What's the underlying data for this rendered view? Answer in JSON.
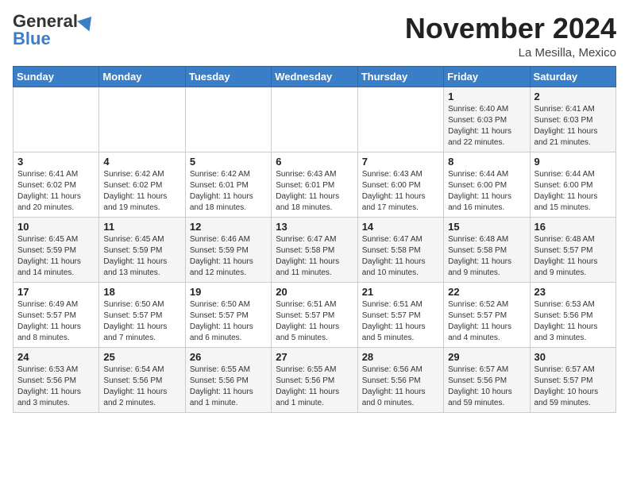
{
  "logo": {
    "general": "General",
    "blue": "Blue"
  },
  "title": "November 2024",
  "location": "La Mesilla, Mexico",
  "days_of_week": [
    "Sunday",
    "Monday",
    "Tuesday",
    "Wednesday",
    "Thursday",
    "Friday",
    "Saturday"
  ],
  "weeks": [
    [
      {
        "day": "",
        "info": ""
      },
      {
        "day": "",
        "info": ""
      },
      {
        "day": "",
        "info": ""
      },
      {
        "day": "",
        "info": ""
      },
      {
        "day": "",
        "info": ""
      },
      {
        "day": "1",
        "info": "Sunrise: 6:40 AM\nSunset: 6:03 PM\nDaylight: 11 hours\nand 22 minutes."
      },
      {
        "day": "2",
        "info": "Sunrise: 6:41 AM\nSunset: 6:03 PM\nDaylight: 11 hours\nand 21 minutes."
      }
    ],
    [
      {
        "day": "3",
        "info": "Sunrise: 6:41 AM\nSunset: 6:02 PM\nDaylight: 11 hours\nand 20 minutes."
      },
      {
        "day": "4",
        "info": "Sunrise: 6:42 AM\nSunset: 6:02 PM\nDaylight: 11 hours\nand 19 minutes."
      },
      {
        "day": "5",
        "info": "Sunrise: 6:42 AM\nSunset: 6:01 PM\nDaylight: 11 hours\nand 18 minutes."
      },
      {
        "day": "6",
        "info": "Sunrise: 6:43 AM\nSunset: 6:01 PM\nDaylight: 11 hours\nand 18 minutes."
      },
      {
        "day": "7",
        "info": "Sunrise: 6:43 AM\nSunset: 6:00 PM\nDaylight: 11 hours\nand 17 minutes."
      },
      {
        "day": "8",
        "info": "Sunrise: 6:44 AM\nSunset: 6:00 PM\nDaylight: 11 hours\nand 16 minutes."
      },
      {
        "day": "9",
        "info": "Sunrise: 6:44 AM\nSunset: 6:00 PM\nDaylight: 11 hours\nand 15 minutes."
      }
    ],
    [
      {
        "day": "10",
        "info": "Sunrise: 6:45 AM\nSunset: 5:59 PM\nDaylight: 11 hours\nand 14 minutes."
      },
      {
        "day": "11",
        "info": "Sunrise: 6:45 AM\nSunset: 5:59 PM\nDaylight: 11 hours\nand 13 minutes."
      },
      {
        "day": "12",
        "info": "Sunrise: 6:46 AM\nSunset: 5:59 PM\nDaylight: 11 hours\nand 12 minutes."
      },
      {
        "day": "13",
        "info": "Sunrise: 6:47 AM\nSunset: 5:58 PM\nDaylight: 11 hours\nand 11 minutes."
      },
      {
        "day": "14",
        "info": "Sunrise: 6:47 AM\nSunset: 5:58 PM\nDaylight: 11 hours\nand 10 minutes."
      },
      {
        "day": "15",
        "info": "Sunrise: 6:48 AM\nSunset: 5:58 PM\nDaylight: 11 hours\nand 9 minutes."
      },
      {
        "day": "16",
        "info": "Sunrise: 6:48 AM\nSunset: 5:57 PM\nDaylight: 11 hours\nand 9 minutes."
      }
    ],
    [
      {
        "day": "17",
        "info": "Sunrise: 6:49 AM\nSunset: 5:57 PM\nDaylight: 11 hours\nand 8 minutes."
      },
      {
        "day": "18",
        "info": "Sunrise: 6:50 AM\nSunset: 5:57 PM\nDaylight: 11 hours\nand 7 minutes."
      },
      {
        "day": "19",
        "info": "Sunrise: 6:50 AM\nSunset: 5:57 PM\nDaylight: 11 hours\nand 6 minutes."
      },
      {
        "day": "20",
        "info": "Sunrise: 6:51 AM\nSunset: 5:57 PM\nDaylight: 11 hours\nand 5 minutes."
      },
      {
        "day": "21",
        "info": "Sunrise: 6:51 AM\nSunset: 5:57 PM\nDaylight: 11 hours\nand 5 minutes."
      },
      {
        "day": "22",
        "info": "Sunrise: 6:52 AM\nSunset: 5:57 PM\nDaylight: 11 hours\nand 4 minutes."
      },
      {
        "day": "23",
        "info": "Sunrise: 6:53 AM\nSunset: 5:56 PM\nDaylight: 11 hours\nand 3 minutes."
      }
    ],
    [
      {
        "day": "24",
        "info": "Sunrise: 6:53 AM\nSunset: 5:56 PM\nDaylight: 11 hours\nand 3 minutes."
      },
      {
        "day": "25",
        "info": "Sunrise: 6:54 AM\nSunset: 5:56 PM\nDaylight: 11 hours\nand 2 minutes."
      },
      {
        "day": "26",
        "info": "Sunrise: 6:55 AM\nSunset: 5:56 PM\nDaylight: 11 hours\nand 1 minute."
      },
      {
        "day": "27",
        "info": "Sunrise: 6:55 AM\nSunset: 5:56 PM\nDaylight: 11 hours\nand 1 minute."
      },
      {
        "day": "28",
        "info": "Sunrise: 6:56 AM\nSunset: 5:56 PM\nDaylight: 11 hours\nand 0 minutes."
      },
      {
        "day": "29",
        "info": "Sunrise: 6:57 AM\nSunset: 5:56 PM\nDaylight: 10 hours\nand 59 minutes."
      },
      {
        "day": "30",
        "info": "Sunrise: 6:57 AM\nSunset: 5:57 PM\nDaylight: 10 hours\nand 59 minutes."
      }
    ]
  ]
}
